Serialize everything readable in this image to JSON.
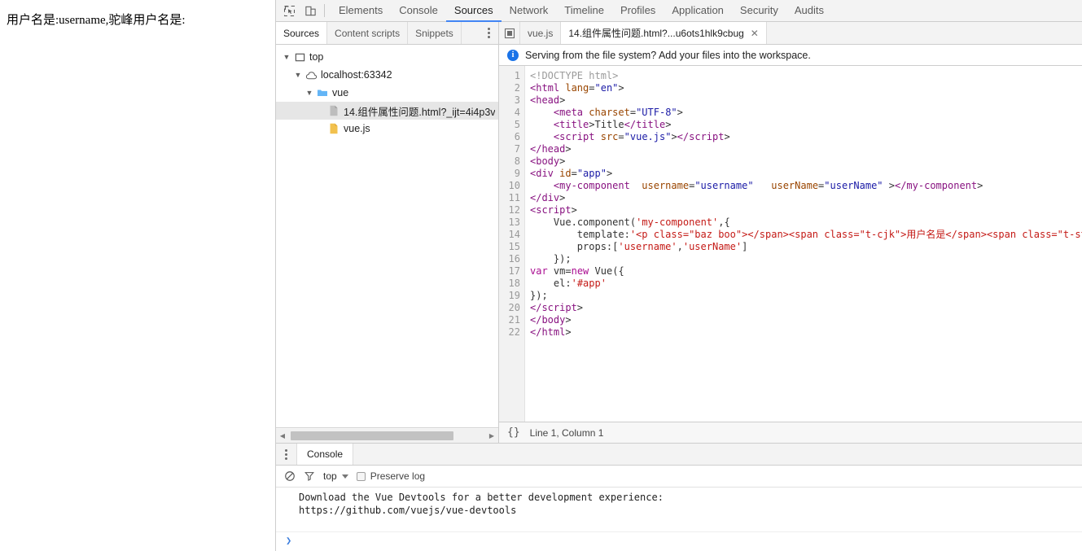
{
  "page": {
    "paragraph": "用户名是:username,驼峰用户名是:"
  },
  "devtools": {
    "toolbar": {
      "inspect_icon": "inspect-element-icon",
      "device_icon": "device-toolbar-icon",
      "tabs": [
        {
          "label": "Elements",
          "active": false
        },
        {
          "label": "Console",
          "active": false
        },
        {
          "label": "Sources",
          "active": true
        },
        {
          "label": "Network",
          "active": false
        },
        {
          "label": "Timeline",
          "active": false
        },
        {
          "label": "Profiles",
          "active": false
        },
        {
          "label": "Application",
          "active": false
        },
        {
          "label": "Security",
          "active": false
        },
        {
          "label": "Audits",
          "active": false
        }
      ],
      "active_tab_color": "#4285f4"
    },
    "navigator": {
      "tabs": [
        {
          "label": "Sources",
          "active": true
        },
        {
          "label": "Content scripts",
          "active": false
        },
        {
          "label": "Snippets",
          "active": false
        }
      ],
      "more_icon": "kebab-menu-icon",
      "tree": [
        {
          "label": "top",
          "icon": "frame-icon",
          "depth": 0,
          "expanded": true,
          "selected": false
        },
        {
          "label": "localhost:63342",
          "icon": "cloud-icon",
          "depth": 1,
          "expanded": true,
          "selected": false
        },
        {
          "label": "vue",
          "icon": "folder-icon",
          "depth": 2,
          "expanded": true,
          "selected": false
        },
        {
          "label": "14.组件属性问题.html?_ijt=4i4p3v",
          "icon": "html-file-icon",
          "depth": 3,
          "expanded": null,
          "selected": true
        },
        {
          "label": "vue.js",
          "icon": "js-file-icon",
          "depth": 3,
          "expanded": null,
          "selected": false
        }
      ],
      "scrollbar": {
        "left_arrow": "◀",
        "right_arrow": "▶"
      }
    },
    "editor": {
      "nav_back_icon": "tabs-list-icon",
      "tabs": [
        {
          "label": "vue.js",
          "active": false,
          "closable": false
        },
        {
          "label": "14.组件属性问题.html?...u6ots1hlk9cbug",
          "active": true,
          "closable": true
        }
      ],
      "close_glyph": "✕",
      "info_bar": {
        "icon": "info-icon",
        "icon_glyph": "i",
        "text": "Serving from the file system? Add your files into the workspace."
      },
      "line_numbers": [
        1,
        2,
        3,
        4,
        5,
        6,
        7,
        8,
        9,
        10,
        11,
        12,
        13,
        14,
        15,
        16,
        17,
        18,
        19,
        20,
        21,
        22
      ],
      "code": [
        "<!DOCTYPE html>",
        "<html lang=\"en\">",
        "<head>",
        "    <meta charset=\"UTF-8\">",
        "    <title>Title</title>",
        "    <script src=\"vue.js\"></script>",
        "</head>",
        "<body>",
        "<div id=\"app\">",
        "    <my-component  username=\"username\"   userName=\"userName\" ></my-component>",
        "</div>",
        "<script>",
        "    Vue.component('my-component',{",
        "        template:'<p class=\"baz boo\">用户名是:{{username}},驼峰用户名是:{{userName}}</p>',",
        "        props:['username','userName']",
        "    });",
        "var vm=new Vue({",
        "    el:'#app'",
        "});",
        "</script>",
        "</body>",
        "</html>"
      ],
      "status": {
        "pretty_print_label": "{}",
        "position": "Line 1, Column 1"
      }
    },
    "drawer": {
      "kebab_icon": "kebab-menu-icon",
      "tabs": [
        {
          "label": "Console",
          "active": true
        }
      ],
      "console_toolbar": {
        "clear_icon": "clear-console-icon",
        "filter_icon": "filter-icon",
        "context": "top",
        "preserve_log_label": "Preserve log",
        "preserve_log_checked": false
      },
      "messages": [
        "Download the Vue Devtools for a better development experience:\nhttps://github.com/vuejs/vue-devtools"
      ],
      "prompt_glyph": "❯"
    }
  }
}
